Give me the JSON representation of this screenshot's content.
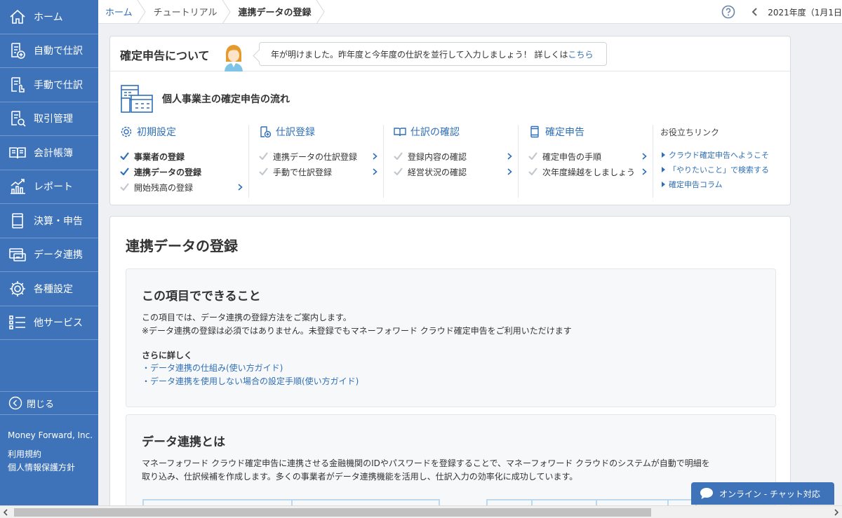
{
  "sidebar": {
    "items": [
      {
        "label": "ホーム"
      },
      {
        "label": "自動で仕訳"
      },
      {
        "label": "手動で仕訳"
      },
      {
        "label": "取引管理"
      },
      {
        "label": "会計帳簿"
      },
      {
        "label": "レポート"
      },
      {
        "label": "決算・申告"
      },
      {
        "label": "データ連携"
      },
      {
        "label": "各種設定"
      },
      {
        "label": "他サービス"
      }
    ],
    "close_label": "閉じる",
    "company": "Money Forward, Inc.",
    "terms": "利用規約",
    "privacy": "個人情報保護方針",
    "bg_color": "#3e73b9"
  },
  "breadcrumb": {
    "home": "ホーム",
    "tutorial": "チュートリアル",
    "current": "連携データの登録"
  },
  "topbar": {
    "fiscal_year": "2021年度（1月1日"
  },
  "about": {
    "title": "確定申告について",
    "bubble_text": "年が明けました。昨年度と今年度の仕訳を並行して入力しましょう！ 詳しくは",
    "bubble_link": "こちら",
    "flow_title": "個人事業主の確定申告の流れ"
  },
  "flow": {
    "columns": [
      {
        "title": "初期設定",
        "icon": "gear-icon",
        "items": [
          {
            "label": "事業者の登録",
            "done": true
          },
          {
            "label": "連携データの登録",
            "done": true
          },
          {
            "label": "開始残高の登録",
            "done": false
          }
        ]
      },
      {
        "title": "仕訳登録",
        "icon": "doc-plus-icon",
        "items": [
          {
            "label": "連携データの仕訳登録",
            "done": false
          },
          {
            "label": "手動で仕訳登録",
            "done": false
          }
        ]
      },
      {
        "title": "仕訳の確認",
        "icon": "book-icon",
        "items": [
          {
            "label": "登録内容の確認",
            "done": false
          },
          {
            "label": "経営状況の確認",
            "done": false
          }
        ]
      },
      {
        "title": "確定申告",
        "icon": "tablet-icon",
        "items": [
          {
            "label": "確定申告の手順",
            "done": false
          },
          {
            "label": "次年度繰越をしましょう",
            "done": false
          }
        ]
      }
    ],
    "links_title": "お役立ちリンク",
    "links": [
      "クラウド確定申告へようこそ",
      "「やりたいこと」で検索する",
      "確定申告コラム"
    ]
  },
  "main": {
    "page_title": "連携データの登録",
    "section1": {
      "title": "この項目でできること",
      "line1": "この項目では、データ連携の登録方法をご案内します。",
      "line2": "※データ連携の登録は必須ではありません。未登録でもマネーフォワード クラウド確定申告をご利用いただけます",
      "more_title": "さらに詳しく",
      "guide1": "・データ連携の仕組み(使い方ガイド)",
      "guide2": "・データ連携を使用しない場合の設定手順(使い方ガイド)"
    },
    "section2": {
      "title": "データ連携とは",
      "line1": "マネーフォワード クラウド確定申告に連携させる金融機関のIDやパスワードを登録することで、マネーフォワード クラウドのシステムが自動で明細を",
      "line2": "取り込み、仕訳候補を作成します。多くの事業者がデータ連携機能を活用し、仕訳入力の効率化に成功しています。"
    }
  },
  "chat": {
    "label": "オンライン - チャット対応"
  },
  "colors": {
    "accent": "#2f6fb7",
    "check": "#2f6fb7",
    "check_off": "#b8bec6"
  }
}
